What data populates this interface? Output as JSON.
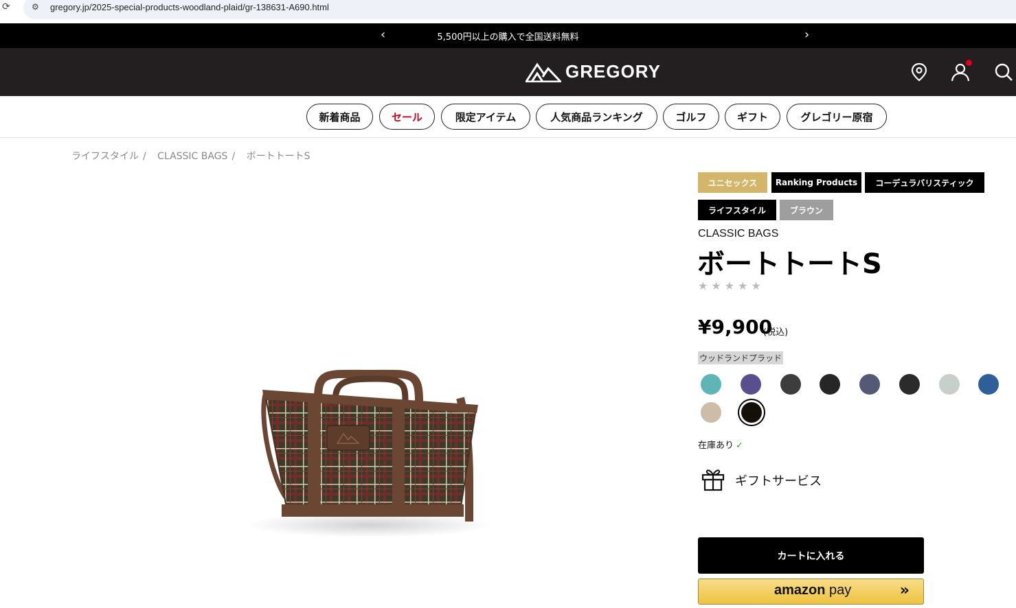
{
  "browser": {
    "url": "gregory.jp/2025-special-products-woodland-plaid/gr-138631-A690.html"
  },
  "announcement": {
    "text": "5,500円以上の購入で全国送料無料",
    "prev_icon": "chevron-left-icon",
    "next_icon": "chevron-right-icon"
  },
  "header": {
    "logo_text": "GREGORY",
    "icons": [
      "location-icon",
      "account-icon",
      "search-icon"
    ]
  },
  "nav": {
    "items": [
      "新着商品",
      "セール",
      "限定アイテム",
      "人気商品ランキング",
      "ゴルフ",
      "ギフト",
      "グレゴリー原宿"
    ]
  },
  "breadcrumb": [
    "ライフスタイル",
    "CLASSIC BAGS",
    "ボートトートS"
  ],
  "product": {
    "tags": [
      {
        "label": "ユニセックス",
        "color": "#d4b56a"
      },
      {
        "label": "Ranking Products",
        "color": "#000000"
      },
      {
        "label": "コーデュラバリスティック",
        "color": "#000000"
      },
      {
        "label": "ライフスタイル",
        "color": "#000000"
      },
      {
        "label": "ブラウン",
        "color": "#9e9e9e"
      }
    ],
    "brand_line": "CLASSIC BAGS",
    "name": "ボートトートS",
    "rating_stars": "★★★★★",
    "rating_value": 0,
    "price": "¥9,900",
    "tax_note": "(税込)",
    "selected_color": "ウッドランドプラッド",
    "swatches": [
      {
        "name": "teal",
        "color": "#5fb4b8"
      },
      {
        "name": "purple",
        "color": "#5a4f8e"
      },
      {
        "name": "charcoal",
        "color": "#3d3d3d"
      },
      {
        "name": "black",
        "color": "#262626"
      },
      {
        "name": "navy-pattern",
        "color": "#545a74"
      },
      {
        "name": "black-pattern",
        "color": "#2b2b2b"
      },
      {
        "name": "light-gray-pattern",
        "color": "#c6cfca"
      },
      {
        "name": "blue",
        "color": "#2f5f98"
      },
      {
        "name": "beige",
        "color": "#cdbca8"
      },
      {
        "name": "woodland-plaid",
        "color": "#4a3b2c",
        "selected": true
      }
    ],
    "stock_text": "在庫あり",
    "stock_icon": "check-icon",
    "gift_label": "ギフトサービス",
    "gift_icon": "gift-icon",
    "cart_button": "カートに入れる",
    "amazon_pay": {
      "brand": "amazon",
      "suffix": "pay",
      "icon": "double-chevron-right-icon"
    }
  }
}
